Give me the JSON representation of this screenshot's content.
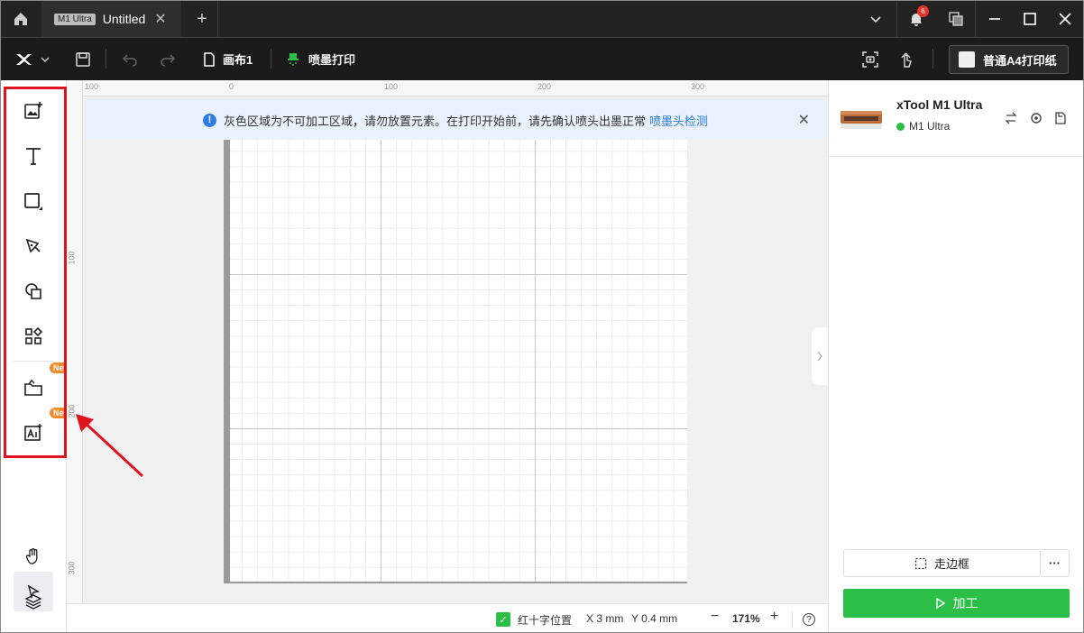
{
  "titlebar": {
    "tab_badge": "M1 Ultra",
    "tab_title": "Untitled",
    "tab_close": "✕",
    "new_tab": "+",
    "notification_count": "6"
  },
  "toolbar": {
    "canvas_name": "画布1",
    "print_mode": "喷墨打印",
    "paper_label": "普通A4打印纸"
  },
  "sidebar": {
    "items": [
      {
        "name": "image"
      },
      {
        "name": "text",
        "glyph": "T"
      },
      {
        "name": "shape"
      },
      {
        "name": "pen"
      },
      {
        "name": "combine"
      },
      {
        "name": "elements"
      },
      {
        "name": "material",
        "tag": "New"
      },
      {
        "name": "ai-image",
        "tag": "New"
      }
    ],
    "tools": [
      "select",
      "hand",
      "layers"
    ]
  },
  "ruler": {
    "top": [
      "100",
      "0",
      "100",
      "200",
      "300"
    ],
    "left": [
      "100",
      "200",
      "300"
    ]
  },
  "notice": {
    "text": "灰色区域为不可加工区域，请勿放置元素。在打印开始前，请先确认喷头出墨正常",
    "link": "喷墨头检测",
    "close": "✕",
    "info": "!"
  },
  "statusbar": {
    "crosshair_label": "红十字位置",
    "crosshair_checked": true,
    "x": "X 3 mm",
    "y": "Y 0.4 mm",
    "zoom_out": "−",
    "zoom": "171%",
    "zoom_in": "+",
    "help": "?"
  },
  "right_panel": {
    "machine_name": "xTool M1 Ultra",
    "machine_model": "M1 Ultra",
    "status_color": "#2bbf47",
    "frame_button": "走边框",
    "more_button": "···",
    "process_button": "加工"
  },
  "colors": {
    "accent_green": "#2bbf47",
    "link_blue": "#2f7de1",
    "highlight_red": "#e0141e",
    "new_orange": "#f08a2a"
  }
}
